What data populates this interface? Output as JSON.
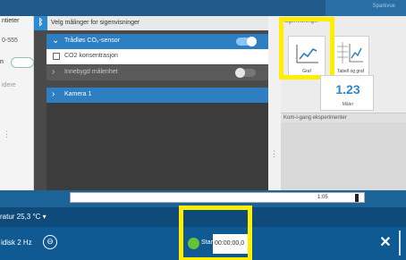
{
  "left": {
    "options_label": "ntieter",
    "device_id": "0-555",
    "toggle_label": "n",
    "value_label": "idere"
  },
  "sensors": {
    "header_title": "Velg målinger for sigenvisninger",
    "co2_sensor": "Trådløs CO₂-sensor",
    "co2_concentration": "CO2 konsentrasjon",
    "builtin_sensor": "Innebygd målenhet",
    "camera": "Kamera 1",
    "co2_enabled": true,
    "builtin_enabled": false
  },
  "display": {
    "title": "sigenvisninger",
    "graph_label": "Graf",
    "table_graph_label": "Tabell og graf",
    "table_header": "X | Y",
    "meter_value": "1.23",
    "meter_label": "Måler",
    "running_title": "Kom-i-gang eksperimenter"
  },
  "timeline": {
    "scale_label": "1:05",
    "position": 0.98
  },
  "status": {
    "temperature": "ratur 25,3 °C ▾"
  },
  "toolbar": {
    "rate": "idisk 2 Hz",
    "rate_icon": "⊖",
    "start_label": "Start",
    "time": "00:00:00,0",
    "tools_icon": "✕"
  },
  "top": {
    "right_text": "Sparkvue"
  },
  "colors": {
    "accent_blue": "#2d7fc1",
    "toolbar_blue": "#0f5a92",
    "highlight_yellow": "#ffee00",
    "start_green": "#67c23a"
  }
}
